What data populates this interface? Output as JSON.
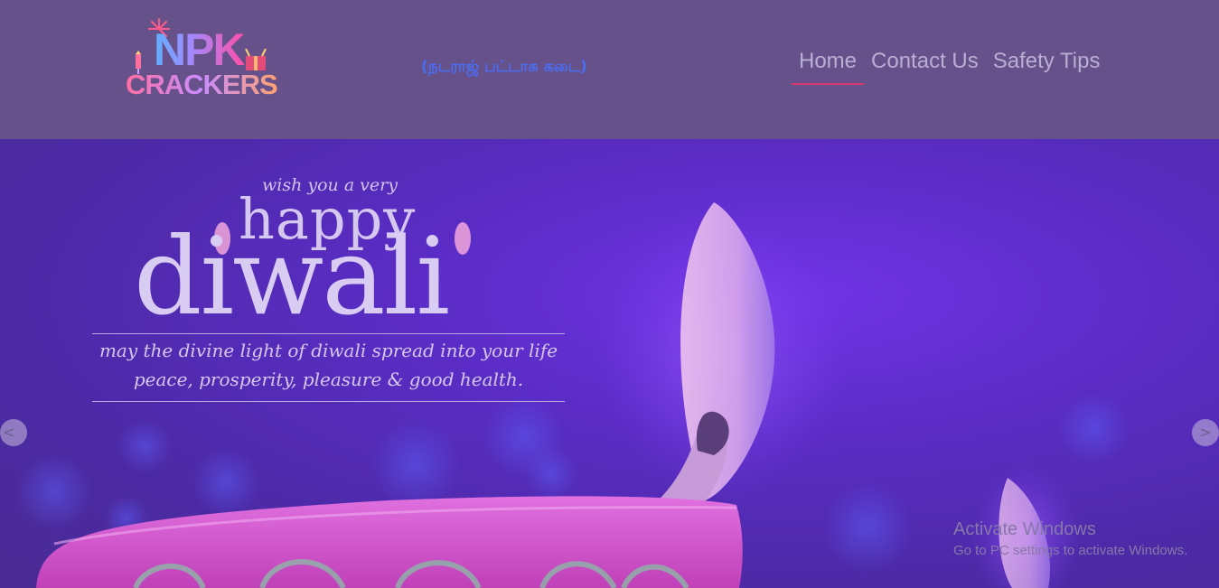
{
  "header": {
    "logo": {
      "line1": "NPK",
      "line2": "CRACKERS"
    },
    "tagline": "(நடராஜ் பட்டாசு கடை)",
    "nav": [
      {
        "label": "Home",
        "active": true
      },
      {
        "label": "Contact Us",
        "active": false
      },
      {
        "label": "Safety Tips",
        "active": false
      }
    ]
  },
  "hero": {
    "wish": "wish you a very",
    "happy": "happy",
    "diwali": "diwali",
    "line1": "may the divine light of diwali spread into your life",
    "line2": "peace, prosperity, pleasure & good health.",
    "prev_label": "<",
    "next_label": ">"
  },
  "watermark": {
    "title": "Activate Windows",
    "subtitle": "Go to PC settings to activate Windows."
  },
  "colors": {
    "header_bg": "#66518a",
    "nav_text": "#b9aed3",
    "nav_active_underline": "#d63a71",
    "tagline": "#4a6df2",
    "hero_bg": "#5a2cc4"
  }
}
